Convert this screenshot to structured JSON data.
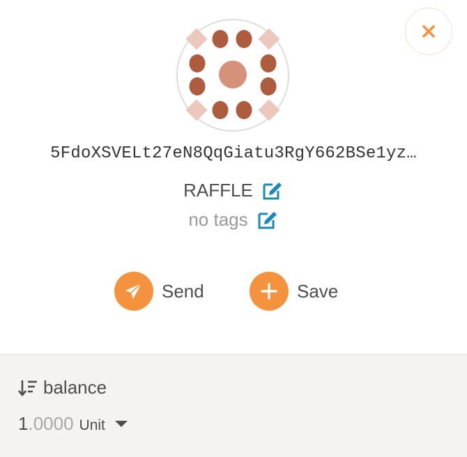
{
  "account": {
    "address": "5FdoXSVELt27eN8QqGiatu3RgY662BSe1yz…",
    "name": "RAFFLE",
    "tags": "no tags"
  },
  "actions": {
    "send_label": "Send",
    "save_label": "Save"
  },
  "balance": {
    "sort_label": "balance",
    "integer": "1",
    "decimals": ".0000",
    "unit": "Unit"
  },
  "icons": {
    "close": "close-icon",
    "edit": "edit-icon",
    "send": "paper-plane-icon",
    "save": "plus-icon",
    "sort": "sort-descending-icon",
    "dropdown": "caret-down-icon"
  },
  "colors": {
    "accent": "#f5923e",
    "edit_blue": "#1a8bb9",
    "identicon_dot": "#ae5c3e",
    "identicon_center": "#d6917a",
    "identicon_diamond": "#ecc7bc",
    "bottom_bg": "#f4f3f2"
  }
}
